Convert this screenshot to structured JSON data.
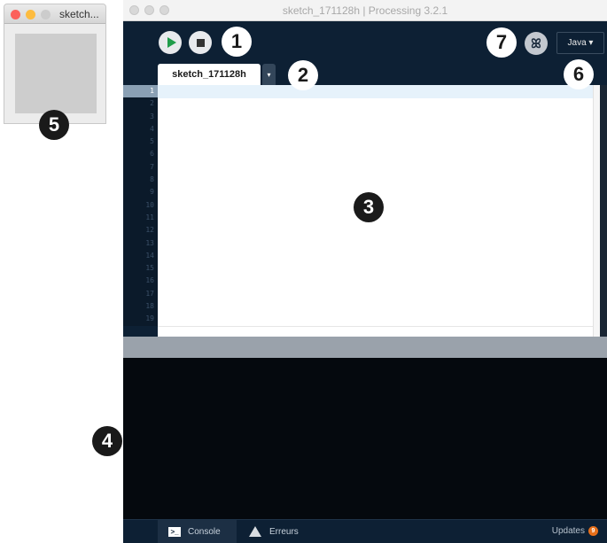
{
  "sketch_window": {
    "title": "sketch...",
    "traffic_light_colors": [
      "#fc605b",
      "#fdbc40",
      "#cccccc"
    ]
  },
  "ide": {
    "title": "sketch_171128h | Processing 3.2.1",
    "toolbar": {
      "run_icon": "play-icon",
      "stop_icon": "stop-icon",
      "debug_glyph": "ꕤ",
      "mode_label": "Java ▾"
    },
    "tab": {
      "label": "sketch_171128h",
      "menu_glyph": "▾"
    },
    "editor": {
      "line_numbers": [
        "1",
        "2",
        "3",
        "4",
        "5",
        "6",
        "7",
        "8",
        "9",
        "10",
        "11",
        "12",
        "13",
        "14",
        "15",
        "16",
        "17",
        "18",
        "19"
      ]
    },
    "footer": {
      "console_label": "Console",
      "errors_label": "Erreurs",
      "updates_label": "Updates",
      "updates_count": "9"
    }
  },
  "callouts": [
    "1",
    "2",
    "3",
    "4",
    "5",
    "6",
    "7"
  ],
  "colors": {
    "ide_background": "#0d2034",
    "run_green": "#1f9c4a",
    "console_background": "#05090e",
    "updates_badge": "#e76f1a"
  }
}
